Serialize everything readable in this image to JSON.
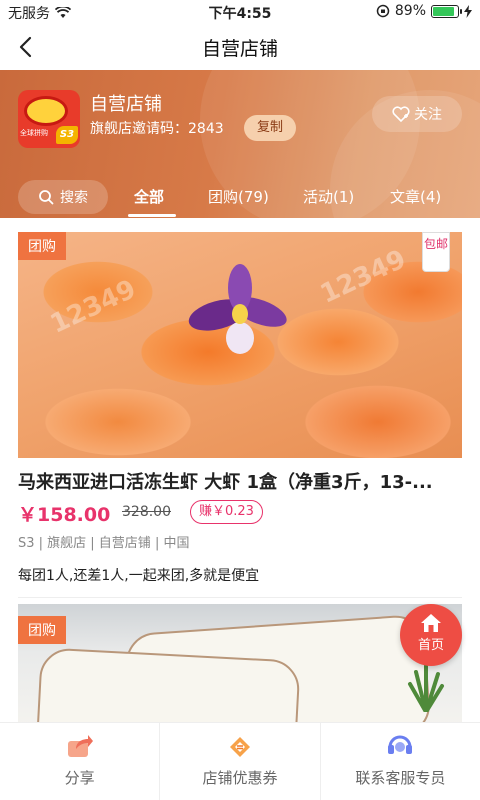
{
  "status_bar": {
    "carrier": "无服务",
    "time": "下午4:55",
    "battery": "89%",
    "battery_level": 0.89
  },
  "nav": {
    "title": "自营店铺"
  },
  "store": {
    "name": "自营店铺",
    "invite_code_label": "旗舰店邀请码：2843",
    "copy_label": "复制",
    "follow_label": "关注",
    "logo_text": "全球拼购",
    "logo_badge": "S3"
  },
  "tabs": {
    "search": "搜索",
    "items": [
      "全部",
      "团购(79)",
      "活动(1)",
      "文章(4)"
    ]
  },
  "products": [
    {
      "badge": "团购",
      "corner": "包邮",
      "title": "马来西亚进口活冻生虾 大虾 1盒（净重3斤，13-...",
      "price": "￥158.00",
      "original_price": "328.00",
      "earn": "赚￥0.23",
      "tags": "S3 | 旗舰店 | 自营店铺 | 中国",
      "desc": "每团1人,还差1人,一起来团,多就是便宜"
    },
    {
      "badge": "团购"
    }
  ],
  "home_fab": {
    "label": "首页"
  },
  "bottom_bar": {
    "share": "分享",
    "coupons": "店铺优惠券",
    "service": "联系客服专员"
  },
  "colors": {
    "header": "#d77a48",
    "accent": "#e8336b",
    "badge": "#ef7340",
    "fab": "#ee4d44"
  }
}
